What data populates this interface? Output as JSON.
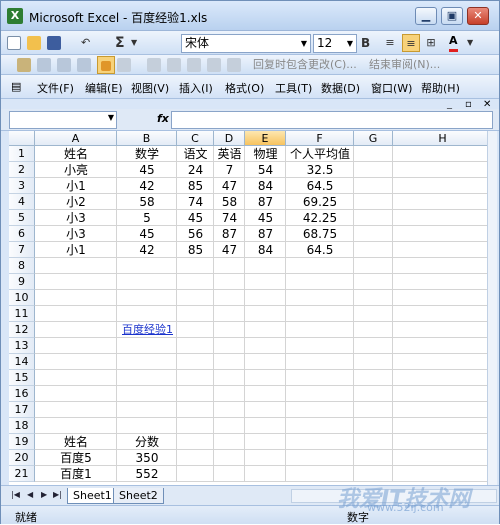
{
  "window": {
    "title": "Microsoft Excel - 百度经验1.xls",
    "logo_letter": "X"
  },
  "toolbar1": {
    "sigma": "Σ",
    "font_name": "宋体",
    "font_size": "12",
    "bold": "B",
    "font_color_label": "A"
  },
  "toolbar2": {
    "reply": "回复时包含更改(C)...",
    "end_review": "结束审阅(N)..."
  },
  "menu": [
    "文件(F)",
    "编辑(E)",
    "视图(V)",
    "插入(I)",
    "格式(O)",
    "工具(T)",
    "数据(D)",
    "窗口(W)",
    "帮助(H)"
  ],
  "formula_bar": {
    "name_box": "",
    "fx": "fx",
    "formula": ""
  },
  "columns": [
    "A",
    "B",
    "C",
    "D",
    "E",
    "F",
    "G",
    "H"
  ],
  "selected_column": "E",
  "rows": [
    "1",
    "2",
    "3",
    "4",
    "5",
    "6",
    "7",
    "8",
    "9",
    "10",
    "11",
    "12",
    "13",
    "14",
    "15",
    "16",
    "17",
    "18",
    "19",
    "20",
    "21"
  ],
  "table": [
    [
      "姓名",
      "数学",
      "语文",
      "英语",
      "物理",
      "个人平均值"
    ],
    [
      "小亮",
      "45",
      "24",
      "7",
      "54",
      "32.5"
    ],
    [
      "小1",
      "42",
      "85",
      "47",
      "84",
      "64.5"
    ],
    [
      "小2",
      "58",
      "74",
      "58",
      "87",
      "69.25"
    ],
    [
      "小3",
      "5",
      "45",
      "74",
      "45",
      "42.25"
    ],
    [
      "小3",
      "45",
      "56",
      "87",
      "87",
      "68.75"
    ],
    [
      "小1",
      "42",
      "85",
      "47",
      "84",
      "64.5"
    ]
  ],
  "link_cell": "百度经验1",
  "bottom_table": [
    [
      "姓名",
      "分数"
    ],
    [
      "百度5",
      "350"
    ],
    [
      "百度1",
      "552"
    ]
  ],
  "sheets": [
    "Sheet1",
    "Sheet2"
  ],
  "status": {
    "left": "就绪",
    "right": "数字"
  },
  "watermark": {
    "main": "我爱IT技术网",
    "sub": "www.52ij.com"
  }
}
